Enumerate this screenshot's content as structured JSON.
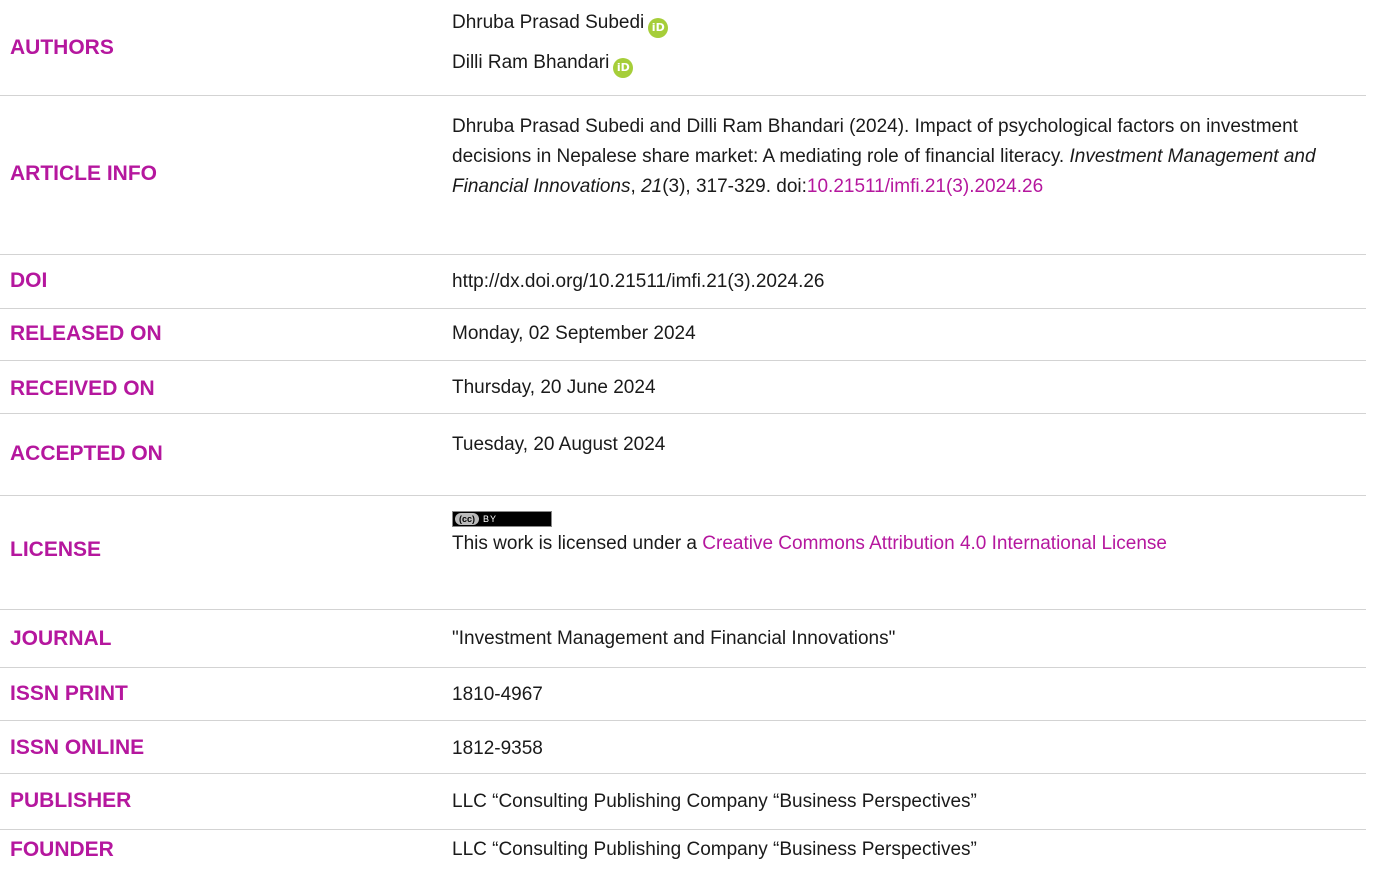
{
  "rows": {
    "authors": {
      "label": "AUTHORS",
      "author1": "Dhruba Prasad Subedi",
      "author2": "Dilli Ram Bhandari"
    },
    "article_info": {
      "label": "ARTICLE INFO",
      "text": "Dhruba Prasad Subedi and Dilli Ram Bhandari (2024). Impact of psychological factors on investment decisions in Nepalese share market: A mediating role of financial literacy. ",
      "journal_italic": "Investment Management and Financial Innovations",
      "comma": ", ",
      "volume_italic": "21",
      "rest": "(3), 317-329. doi:",
      "doi_link": "10.21511/imfi.21(3).2024.26"
    },
    "doi": {
      "label": "DOI",
      "value": "http://dx.doi.org/10.21511/imfi.21(3).2024.26"
    },
    "released": {
      "label": "RELEASED ON",
      "value": "Monday, 02 September 2024"
    },
    "received": {
      "label": "RECEIVED ON",
      "value": "Thursday, 20 June 2024"
    },
    "accepted": {
      "label": "ACCEPTED ON",
      "value": "Tuesday, 20 August 2024"
    },
    "license": {
      "label": "LICENSE",
      "badge_cc": "(cc)",
      "badge_by": "BY",
      "text": "This work is licensed under a ",
      "link": "Creative Commons Attribution 4.0 International License"
    },
    "journal": {
      "label": "JOURNAL",
      "value": "\"Investment Management and Financial Innovations\""
    },
    "issn_print": {
      "label": "ISSN PRINT",
      "value": "1810-4967"
    },
    "issn_online": {
      "label": "ISSN ONLINE",
      "value": "1812-9358"
    },
    "publisher": {
      "label": "PUBLISHER",
      "value": "LLC “Consulting Publishing Company “Business Perspectives”"
    },
    "founder": {
      "label": "FOUNDER",
      "value": "LLC “Consulting Publishing Company “Business Perspectives”"
    }
  },
  "icons": {
    "orcid": "orcid-icon",
    "cc_by": "cc-by-license-badge"
  },
  "colors": {
    "label": "#b5179e",
    "link": "#b5179e",
    "orcid": "#a6ce39",
    "divider": "#d3d3d3"
  }
}
